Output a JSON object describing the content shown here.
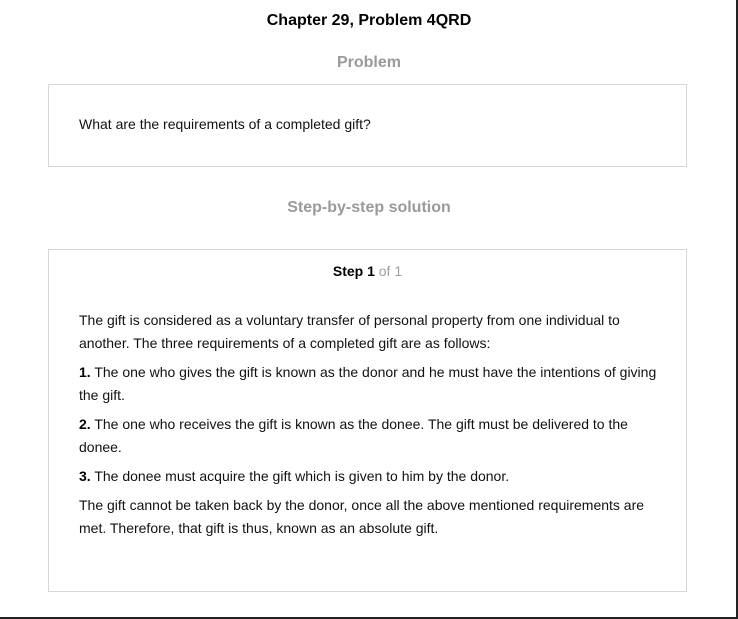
{
  "title": "Chapter 29, Problem 4QRD",
  "problem": {
    "heading": "Problem",
    "text": "What are the requirements of a completed gift?"
  },
  "solution": {
    "heading": "Step-by-step solution",
    "step_word": "Step 1",
    "step_of": "of 1",
    "intro": "The gift is considered as a voluntary transfer of personal property from one individual to another. The three requirements of a completed gift are as follows:",
    "requirements": [
      {
        "number": "1.",
        "text": "The one who gives the gift is known as the donor and he must have the intentions of giving the gift."
      },
      {
        "number": "2.",
        "text": "The one who receives the gift is known as the donee. The gift must be delivered to the donee."
      },
      {
        "number": "3.",
        "text": "The donee must acquire the gift which is given to him by the donor."
      }
    ],
    "conclusion": "The gift cannot be taken back by the donor, once all the above mentioned requirements are met. Therefore, that gift is thus, known as an absolute gift."
  }
}
